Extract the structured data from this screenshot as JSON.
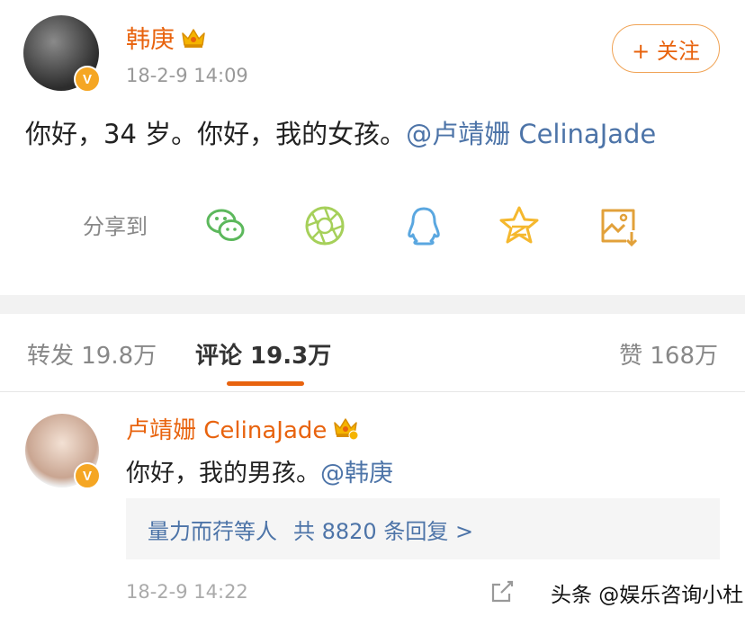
{
  "post": {
    "author": "韩庚",
    "verified_mark": "V",
    "time": "18-2-9 14:09",
    "follow_label": "+ 关注",
    "text": "你好，34 岁。你好，我的女孩。",
    "mention": "@卢靖姗 CelinaJade",
    "share_label": "分享到",
    "share_icons": [
      "wechat-icon",
      "moments-icon",
      "qq-icon",
      "qzone-icon",
      "save-image-icon"
    ]
  },
  "tabs": {
    "repost": "转发 19.8万",
    "comments": "评论 19.3万",
    "likes": "赞 168万"
  },
  "comment": {
    "author": "卢靖姗 CelinaJade",
    "verified_mark": "V",
    "text": "你好，我的男孩。",
    "mention": "@韩庚",
    "reply_user": "量力而荇等人",
    "reply_count": "共 8820 条回复 >",
    "time": "18-2-9 14:22"
  },
  "watermark": "头条 @娱乐咨询小杜",
  "colors": {
    "accent": "#e8630e",
    "link": "#4d74a8",
    "wechat": "#5cb85c",
    "moments": "#a6d05a",
    "qq": "#5aa7e0",
    "qzone": "#f5b82e",
    "save": "#e2a13a"
  }
}
